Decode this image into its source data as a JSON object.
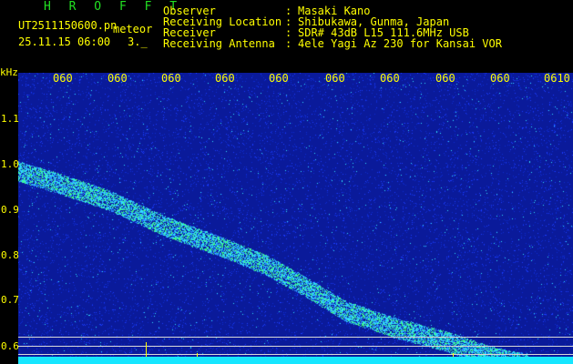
{
  "header": {
    "app_name": "H R O F F T",
    "file_name": "UT2511150600.pn",
    "category": "meteor",
    "datetime": "25.11.15 06:00",
    "page": "3._",
    "fields": [
      {
        "label": "Observer",
        "sep": ":",
        "value": "Masaki Kano"
      },
      {
        "label": "Receiving Location",
        "sep": ":",
        "value": "Shibukawa, Gunma, Japan"
      },
      {
        "label": "Receiver",
        "sep": ":",
        "value": "SDR# 43dB L15 111.6MHz USB"
      },
      {
        "label": "Receiving Antenna",
        "sep": ":",
        "value": "4ele Yagi Az 230 for Kansai VOR"
      }
    ]
  },
  "axes": {
    "y_unit": "kHz",
    "y_ticks": [
      "1.1",
      "1.0",
      "0.9",
      "0.8",
      "0.7",
      "0.6"
    ],
    "x_ticks": [
      "060",
      "060",
      "060",
      "060",
      "060",
      "060",
      "060",
      "060",
      "060",
      "0610"
    ]
  },
  "colors": {
    "background": "#0a1a9a",
    "noise_low": "#1a3cff",
    "noise_high": "#30e0ff",
    "trail": "#40ff80",
    "baseline": "#16e6ff",
    "text": "#ffff00",
    "title": "#22e022"
  }
}
